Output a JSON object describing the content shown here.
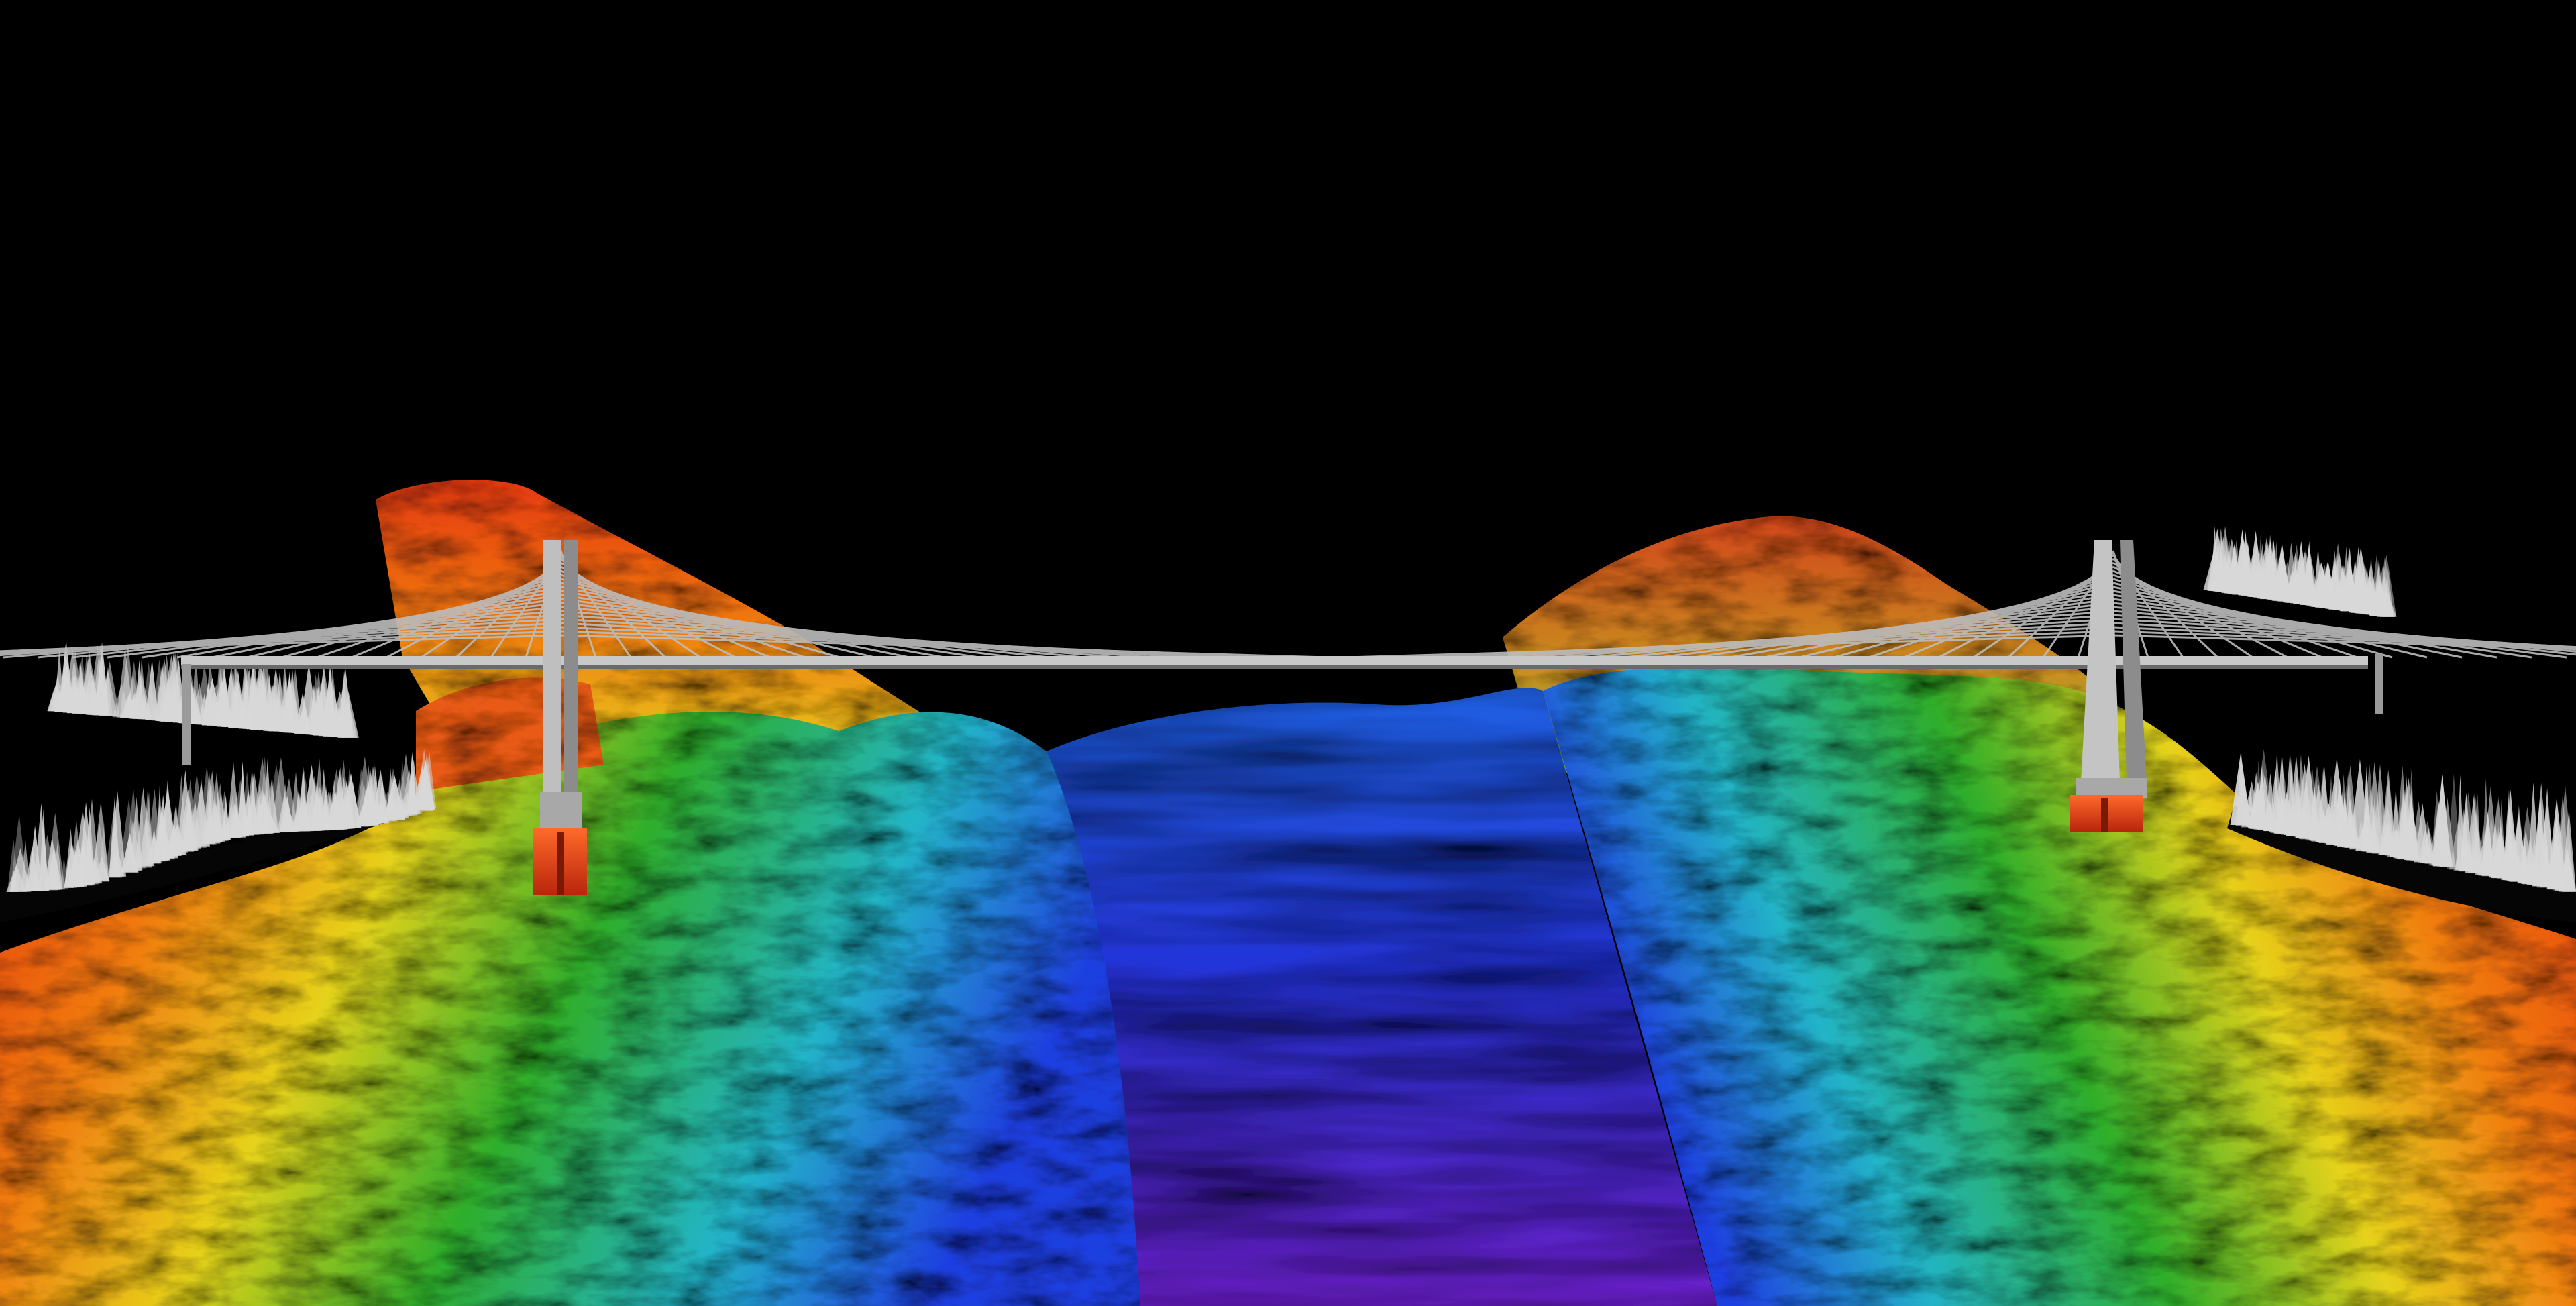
{
  "scene": {
    "kind": "bathymetric-lidar-render",
    "subject": "cable-stayed-bridge-over-fjord-channel",
    "colors": {
      "background": "#000000",
      "deep": "#5a1fc8",
      "mid_deep": "#1f3fe0",
      "cyan": "#22b4c8",
      "green": "#2fae2a",
      "yellow": "#e6d21a",
      "orange": "#f07a10",
      "red": "#e53a12",
      "bridge": "#c9c9c9",
      "pier": "#e0481a",
      "trees": "#d8d8d8"
    },
    "bridge": {
      "towers": 2,
      "stay_cables_per_side": 22
    }
  }
}
